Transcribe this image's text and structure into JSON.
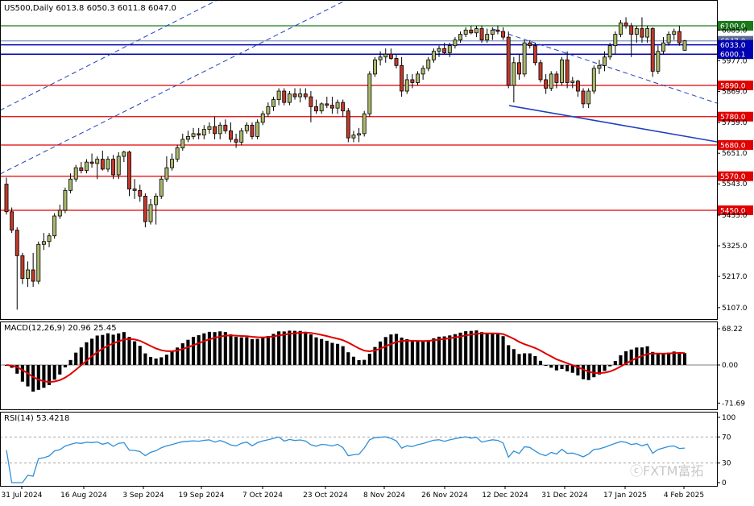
{
  "header": {
    "title": "US500,Daily  6013.8 6050.3 6011.8 6047.0"
  },
  "colors": {
    "up": "#a9b86a",
    "down": "#c0392b",
    "macd_hist": "#000000",
    "macd_signal": "#e00000",
    "rsi": "#2f8fd8",
    "support": "#e00000",
    "resistance": "#1a7a1a",
    "trend": "#1f3fbf",
    "pivot": "#0000b0"
  },
  "watermark": "ⓒFXTM富拓",
  "chart_data": [
    {
      "type": "candlestick",
      "title": "US500,Daily  6013.8 6050.3 6011.8 6047.0",
      "symbol": "US500",
      "timeframe": "Daily",
      "last_ohlc": {
        "open": 6013.8,
        "high": 6050.3,
        "low": 6011.8,
        "close": 6047.0
      },
      "ylim": [
        5075,
        6150
      ],
      "y_ticks": [
        {
          "label": "6085.0",
          "value": 6085.0
        },
        {
          "label": "5977.0",
          "value": 5977.0
        },
        {
          "label": "5869.0",
          "value": 5869.0
        },
        {
          "label": "5759.0",
          "value": 5759.0
        },
        {
          "label": "5651.0",
          "value": 5651.0
        },
        {
          "label": "5543.0",
          "value": 5543.0
        },
        {
          "label": "5433.0",
          "value": 5433.0
        },
        {
          "label": "5325.0",
          "value": 5325.0
        },
        {
          "label": "5217.0",
          "value": 5217.0
        },
        {
          "label": "5107.0",
          "value": 5107.0
        }
      ],
      "x_labels": [
        "31 Jul 2024",
        "16 Aug 2024",
        "3 Sep 2024",
        "19 Sep 2024",
        "7 Oct 2024",
        "23 Oct 2024",
        "8 Nov 2024",
        "26 Nov 2024",
        "12 Dec 2024",
        "31 Dec 2024",
        "17 Jan 2025",
        "4 Feb 2025"
      ],
      "levels": [
        {
          "label": "6100.0",
          "value": 6100.0,
          "color": "#1a7a1a",
          "tag_bg": "#1a7a1a"
        },
        {
          "label": "6047.0",
          "value": 6047.0,
          "color": "#8da0c8",
          "tag_bg": "#5a6a90"
        },
        {
          "label": "6033.0",
          "value": 6033.0,
          "color": "#0000b0",
          "tag_bg": "#0000b0"
        },
        {
          "label": "6000.1",
          "value": 6000.1,
          "color": "#0000b0",
          "tag_bg": "#0000b0"
        },
        {
          "label": "5890.0",
          "value": 5890.0,
          "color": "#e00000",
          "tag_bg": "#e00000"
        },
        {
          "label": "5780.0",
          "value": 5780.0,
          "color": "#e00000",
          "tag_bg": "#e00000"
        },
        {
          "label": "5680.0",
          "value": 5680.0,
          "color": "#e00000",
          "tag_bg": "#e00000"
        },
        {
          "label": "5570.0",
          "value": 5570.0,
          "color": "#e00000",
          "tag_bg": "#e00000"
        },
        {
          "label": "5450.0",
          "value": 5450.0,
          "color": "#e00000",
          "tag_bg": "#e00000"
        }
      ],
      "candles": [
        {
          "o": 5542,
          "h": 5565,
          "l": 5435,
          "c": 5445
        },
        {
          "o": 5445,
          "h": 5460,
          "l": 5370,
          "c": 5380
        },
        {
          "o": 5380,
          "h": 5390,
          "l": 5100,
          "c": 5290
        },
        {
          "o": 5290,
          "h": 5300,
          "l": 5190,
          "c": 5210
        },
        {
          "o": 5210,
          "h": 5270,
          "l": 5180,
          "c": 5240
        },
        {
          "o": 5240,
          "h": 5300,
          "l": 5180,
          "c": 5200
        },
        {
          "o": 5200,
          "h": 5340,
          "l": 5190,
          "c": 5330
        },
        {
          "o": 5330,
          "h": 5370,
          "l": 5310,
          "c": 5340
        },
        {
          "o": 5340,
          "h": 5370,
          "l": 5320,
          "c": 5360
        },
        {
          "o": 5360,
          "h": 5440,
          "l": 5350,
          "c": 5430
        },
        {
          "o": 5430,
          "h": 5470,
          "l": 5420,
          "c": 5450
        },
        {
          "o": 5450,
          "h": 5530,
          "l": 5440,
          "c": 5520
        },
        {
          "o": 5520,
          "h": 5580,
          "l": 5510,
          "c": 5560
        },
        {
          "o": 5560,
          "h": 5610,
          "l": 5550,
          "c": 5600
        },
        {
          "o": 5600,
          "h": 5620,
          "l": 5580,
          "c": 5590
        },
        {
          "o": 5590,
          "h": 5630,
          "l": 5580,
          "c": 5620
        },
        {
          "o": 5620,
          "h": 5650,
          "l": 5600,
          "c": 5615
        },
        {
          "o": 5615,
          "h": 5640,
          "l": 5560,
          "c": 5630
        },
        {
          "o": 5630,
          "h": 5660,
          "l": 5590,
          "c": 5595
        },
        {
          "o": 5595,
          "h": 5640,
          "l": 5585,
          "c": 5630
        },
        {
          "o": 5630,
          "h": 5645,
          "l": 5560,
          "c": 5575
        },
        {
          "o": 5575,
          "h": 5655,
          "l": 5560,
          "c": 5640
        },
        {
          "o": 5640,
          "h": 5660,
          "l": 5620,
          "c": 5655
        },
        {
          "o": 5655,
          "h": 5660,
          "l": 5500,
          "c": 5525
        },
        {
          "o": 5525,
          "h": 5560,
          "l": 5490,
          "c": 5520
        },
        {
          "o": 5520,
          "h": 5540,
          "l": 5480,
          "c": 5500
        },
        {
          "o": 5500,
          "h": 5510,
          "l": 5390,
          "c": 5410
        },
        {
          "o": 5410,
          "h": 5490,
          "l": 5400,
          "c": 5470
        },
        {
          "o": 5470,
          "h": 5510,
          "l": 5400,
          "c": 5500
        },
        {
          "o": 5500,
          "h": 5570,
          "l": 5490,
          "c": 5560
        },
        {
          "o": 5560,
          "h": 5640,
          "l": 5550,
          "c": 5600
        },
        {
          "o": 5600,
          "h": 5650,
          "l": 5590,
          "c": 5630
        },
        {
          "o": 5630,
          "h": 5680,
          "l": 5620,
          "c": 5670
        },
        {
          "o": 5670,
          "h": 5720,
          "l": 5660,
          "c": 5700
        },
        {
          "o": 5700,
          "h": 5730,
          "l": 5690,
          "c": 5710
        },
        {
          "o": 5710,
          "h": 5740,
          "l": 5700,
          "c": 5720
        },
        {
          "o": 5720,
          "h": 5740,
          "l": 5700,
          "c": 5715
        },
        {
          "o": 5715,
          "h": 5750,
          "l": 5700,
          "c": 5735
        },
        {
          "o": 5735,
          "h": 5760,
          "l": 5720,
          "c": 5745
        },
        {
          "o": 5745,
          "h": 5780,
          "l": 5700,
          "c": 5720
        },
        {
          "o": 5720,
          "h": 5760,
          "l": 5700,
          "c": 5750
        },
        {
          "o": 5750,
          "h": 5770,
          "l": 5720,
          "c": 5730
        },
        {
          "o": 5730,
          "h": 5760,
          "l": 5690,
          "c": 5700
        },
        {
          "o": 5700,
          "h": 5720,
          "l": 5670,
          "c": 5690
        },
        {
          "o": 5690,
          "h": 5740,
          "l": 5680,
          "c": 5730
        },
        {
          "o": 5730,
          "h": 5760,
          "l": 5720,
          "c": 5750
        },
        {
          "o": 5750,
          "h": 5760,
          "l": 5700,
          "c": 5710
        },
        {
          "o": 5710,
          "h": 5770,
          "l": 5700,
          "c": 5760
        },
        {
          "o": 5760,
          "h": 5800,
          "l": 5750,
          "c": 5790
        },
        {
          "o": 5790,
          "h": 5830,
          "l": 5780,
          "c": 5815
        },
        {
          "o": 5815,
          "h": 5850,
          "l": 5800,
          "c": 5840
        },
        {
          "o": 5840,
          "h": 5880,
          "l": 5820,
          "c": 5870
        },
        {
          "o": 5870,
          "h": 5880,
          "l": 5820,
          "c": 5830
        },
        {
          "o": 5830,
          "h": 5870,
          "l": 5820,
          "c": 5860
        },
        {
          "o": 5860,
          "h": 5880,
          "l": 5840,
          "c": 5850
        },
        {
          "o": 5850,
          "h": 5880,
          "l": 5830,
          "c": 5860
        },
        {
          "o": 5860,
          "h": 5880,
          "l": 5840,
          "c": 5850
        },
        {
          "o": 5850,
          "h": 5870,
          "l": 5760,
          "c": 5815
        },
        {
          "o": 5815,
          "h": 5840,
          "l": 5790,
          "c": 5800
        },
        {
          "o": 5800,
          "h": 5830,
          "l": 5790,
          "c": 5825
        },
        {
          "o": 5825,
          "h": 5850,
          "l": 5810,
          "c": 5820
        },
        {
          "o": 5820,
          "h": 5850,
          "l": 5790,
          "c": 5810
        },
        {
          "o": 5810,
          "h": 5840,
          "l": 5790,
          "c": 5830
        },
        {
          "o": 5830,
          "h": 5840,
          "l": 5780,
          "c": 5800
        },
        {
          "o": 5800,
          "h": 5810,
          "l": 5690,
          "c": 5705
        },
        {
          "o": 5705,
          "h": 5730,
          "l": 5690,
          "c": 5715
        },
        {
          "o": 5715,
          "h": 5740,
          "l": 5690,
          "c": 5720
        },
        {
          "o": 5720,
          "h": 5800,
          "l": 5710,
          "c": 5790
        },
        {
          "o": 5790,
          "h": 5940,
          "l": 5780,
          "c": 5930
        },
        {
          "o": 5930,
          "h": 5990,
          "l": 5920,
          "c": 5980
        },
        {
          "o": 5980,
          "h": 6010,
          "l": 5960,
          "c": 5990
        },
        {
          "o": 5990,
          "h": 6020,
          "l": 5970,
          "c": 6000
        },
        {
          "o": 6000,
          "h": 6020,
          "l": 5980,
          "c": 5985
        },
        {
          "o": 5985,
          "h": 6000,
          "l": 5950,
          "c": 5960
        },
        {
          "o": 5960,
          "h": 5990,
          "l": 5850,
          "c": 5870
        },
        {
          "o": 5870,
          "h": 5930,
          "l": 5860,
          "c": 5910
        },
        {
          "o": 5910,
          "h": 5930,
          "l": 5880,
          "c": 5900
        },
        {
          "o": 5900,
          "h": 5940,
          "l": 5890,
          "c": 5930
        },
        {
          "o": 5930,
          "h": 5960,
          "l": 5910,
          "c": 5950
        },
        {
          "o": 5950,
          "h": 5990,
          "l": 5940,
          "c": 5980
        },
        {
          "o": 5980,
          "h": 6020,
          "l": 5970,
          "c": 6010
        },
        {
          "o": 6010,
          "h": 6030,
          "l": 5990,
          "c": 6020
        },
        {
          "o": 6020,
          "h": 6040,
          "l": 6000,
          "c": 6005
        },
        {
          "o": 6005,
          "h": 6040,
          "l": 5990,
          "c": 6030
        },
        {
          "o": 6030,
          "h": 6060,
          "l": 6020,
          "c": 6050
        },
        {
          "o": 6050,
          "h": 6080,
          "l": 6040,
          "c": 6070
        },
        {
          "o": 6070,
          "h": 6095,
          "l": 6060,
          "c": 6085
        },
        {
          "o": 6085,
          "h": 6100,
          "l": 6070,
          "c": 6075
        },
        {
          "o": 6075,
          "h": 6100,
          "l": 6060,
          "c": 6090
        },
        {
          "o": 6090,
          "h": 6100,
          "l": 6040,
          "c": 6050
        },
        {
          "o": 6050,
          "h": 6090,
          "l": 6040,
          "c": 6070
        },
        {
          "o": 6070,
          "h": 6095,
          "l": 6050,
          "c": 6085
        },
        {
          "o": 6085,
          "h": 6100,
          "l": 6070,
          "c": 6080
        },
        {
          "o": 6080,
          "h": 6095,
          "l": 6050,
          "c": 6060
        },
        {
          "o": 6060,
          "h": 6080,
          "l": 5880,
          "c": 5890
        },
        {
          "o": 5890,
          "h": 5990,
          "l": 5830,
          "c": 5970
        },
        {
          "o": 5970,
          "h": 6000,
          "l": 5910,
          "c": 5930
        },
        {
          "o": 5930,
          "h": 6050,
          "l": 5920,
          "c": 6040
        },
        {
          "o": 6040,
          "h": 6050,
          "l": 6020,
          "c": 6030
        },
        {
          "o": 6030,
          "h": 6040,
          "l": 5960,
          "c": 5970
        },
        {
          "o": 5970,
          "h": 5980,
          "l": 5900,
          "c": 5910
        },
        {
          "o": 5910,
          "h": 5930,
          "l": 5860,
          "c": 5880
        },
        {
          "o": 5880,
          "h": 5940,
          "l": 5870,
          "c": 5930
        },
        {
          "o": 5930,
          "h": 5940,
          "l": 5880,
          "c": 5900
        },
        {
          "o": 5900,
          "h": 5990,
          "l": 5890,
          "c": 5980
        },
        {
          "o": 5980,
          "h": 6010,
          "l": 5880,
          "c": 5900
        },
        {
          "o": 5900,
          "h": 5920,
          "l": 5880,
          "c": 5905
        },
        {
          "o": 5905,
          "h": 5910,
          "l": 5850,
          "c": 5870
        },
        {
          "o": 5870,
          "h": 5880,
          "l": 5810,
          "c": 5825
        },
        {
          "o": 5825,
          "h": 5880,
          "l": 5810,
          "c": 5870
        },
        {
          "o": 5870,
          "h": 5960,
          "l": 5860,
          "c": 5950
        },
        {
          "o": 5950,
          "h": 5980,
          "l": 5930,
          "c": 5960
        },
        {
          "o": 5960,
          "h": 6010,
          "l": 5940,
          "c": 5990
        },
        {
          "o": 5990,
          "h": 6040,
          "l": 5980,
          "c": 6030
        },
        {
          "o": 6030,
          "h": 6080,
          "l": 6000,
          "c": 6070
        },
        {
          "o": 6070,
          "h": 6120,
          "l": 6060,
          "c": 6110
        },
        {
          "o": 6110,
          "h": 6130,
          "l": 6090,
          "c": 6100
        },
        {
          "o": 6100,
          "h": 6110,
          "l": 5990,
          "c": 6070
        },
        {
          "o": 6070,
          "h": 6100,
          "l": 6040,
          "c": 6090
        },
        {
          "o": 6090,
          "h": 6130,
          "l": 6040,
          "c": 6060
        },
        {
          "o": 6060,
          "h": 6100,
          "l": 6040,
          "c": 6090
        },
        {
          "o": 6090,
          "h": 6095,
          "l": 5920,
          "c": 5940
        },
        {
          "o": 5940,
          "h": 6030,
          "l": 5930,
          "c": 6010
        },
        {
          "o": 6010,
          "h": 6060,
          "l": 6000,
          "c": 6040
        },
        {
          "o": 6040,
          "h": 6080,
          "l": 6030,
          "c": 6070
        },
        {
          "o": 6070,
          "h": 6090,
          "l": 6050,
          "c": 6080
        },
        {
          "o": 6080,
          "h": 6100,
          "l": 6030,
          "c": 6040
        },
        {
          "o": 6013.8,
          "h": 6050.3,
          "l": 6011.8,
          "c": 6047.0
        }
      ]
    },
    {
      "type": "macd",
      "label": "MACD(12,26,9) 20.96 25.45",
      "params": [
        12,
        26,
        9
      ],
      "macd_last": 20.96,
      "signal_last": 25.45,
      "ylim": [
        -71.69,
        68.22
      ],
      "y_ticks": [
        {
          "label": "68.22",
          "value": 68.22
        },
        {
          "label": "0.00",
          "value": 0
        },
        {
          "label": "-71.69",
          "value": -71.69
        }
      ]
    },
    {
      "type": "line",
      "label": "RSI(14) 53.4218",
      "period": 14,
      "last": 53.4218,
      "ylim": [
        0,
        100
      ],
      "y_ticks": [
        {
          "label": "100",
          "value": 100
        },
        {
          "label": "70",
          "value": 70
        },
        {
          "label": "30",
          "value": 30
        },
        {
          "label": "0",
          "value": 0
        }
      ]
    }
  ]
}
